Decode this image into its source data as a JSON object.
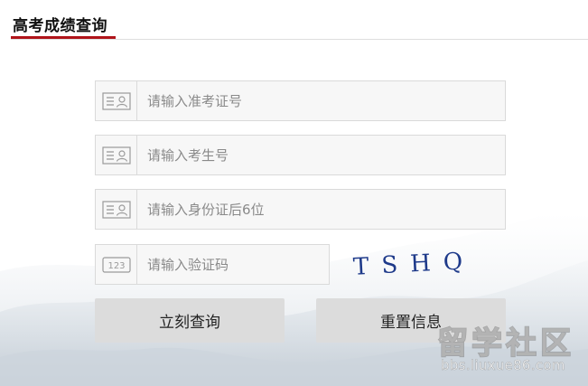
{
  "header": {
    "title": "高考成绩查询"
  },
  "form": {
    "exam_ticket": {
      "placeholder": "请输入准考证号",
      "icon": "id-card-icon"
    },
    "student_no": {
      "placeholder": "请输入考生号",
      "icon": "id-card-icon"
    },
    "id_last6": {
      "placeholder": "请输入身份证后6位",
      "icon": "id-card-icon"
    },
    "captcha": {
      "placeholder": "请输入验证码",
      "icon": "keypad-123-icon",
      "icon_text": "123",
      "code": "TSHQ"
    }
  },
  "buttons": {
    "query": "立刻查询",
    "reset": "重置信息"
  },
  "watermark": {
    "title": "留学社区",
    "url": "bbs.liuxue86.com"
  },
  "colors": {
    "accent": "#b0141a",
    "field_bg": "#f7f7f7",
    "button_bg": "#dcdcdc",
    "captcha_ink": "#1e3a8a"
  }
}
